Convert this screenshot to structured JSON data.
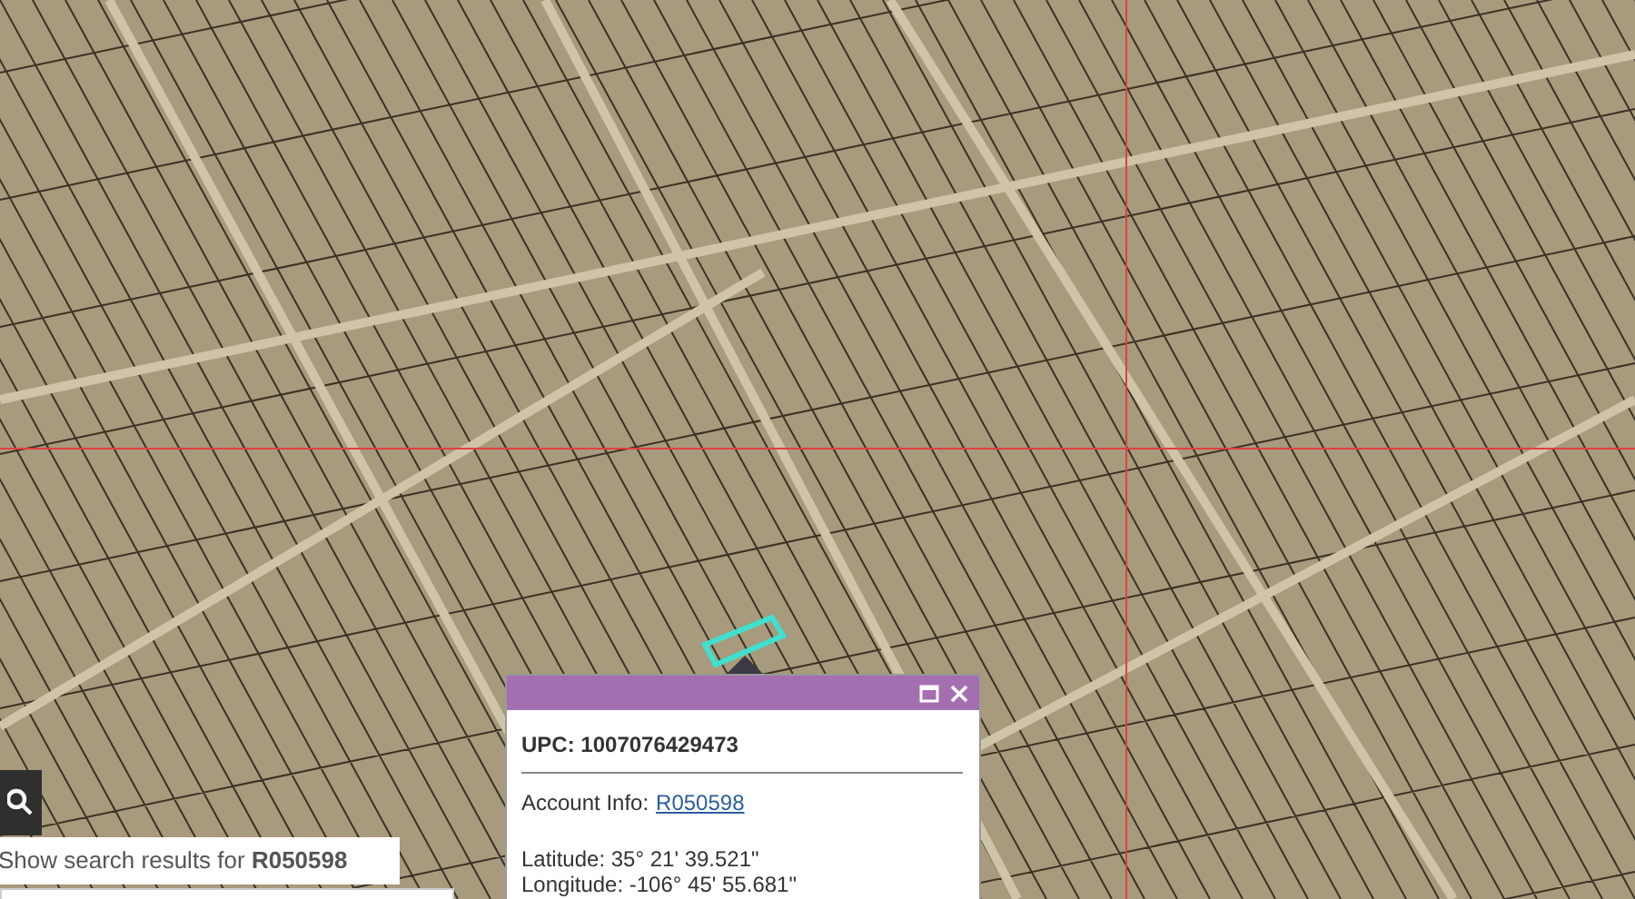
{
  "popup": {
    "upc": "UPC: 1007076429473",
    "account_label": "Account Info:",
    "account_link": "R050598",
    "latitude": "Latitude: 35° 21' 39.521\"",
    "longitude": "Longitude: -106° 45' 55.681\""
  },
  "search": {
    "suggestion": "Show search results for **R050598**"
  }
}
